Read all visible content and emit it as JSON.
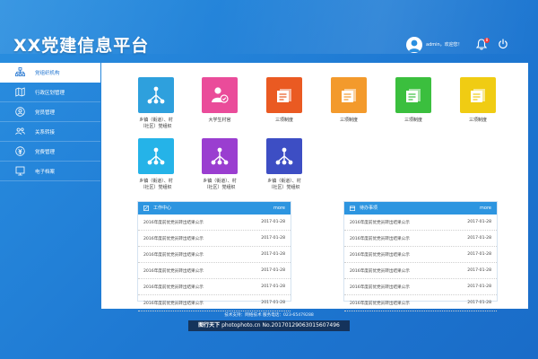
{
  "header": {
    "title": "XX党建信息平台",
    "welcome": "admin，欢迎您！",
    "notification_count": "8"
  },
  "sidebar": {
    "items": [
      {
        "label": "党组织机构",
        "icon": "org-chart-icon"
      },
      {
        "label": "行政区划管理",
        "icon": "map-icon"
      },
      {
        "label": "党员管理",
        "icon": "member-icon"
      },
      {
        "label": "关系转接",
        "icon": "transfer-icon"
      },
      {
        "label": "党费管理",
        "icon": "fee-icon"
      },
      {
        "label": "电子档案",
        "icon": "archive-icon"
      }
    ]
  },
  "tiles": [
    {
      "label": "乡镇（街道）、村\n（社区）党组织",
      "color": "#2ea0dd",
      "icon": "org-tree-icon"
    },
    {
      "label": "大学生村官",
      "color": "#ea4c9a",
      "icon": "person-badge-icon"
    },
    {
      "label": "三项制度",
      "color": "#ea5a22",
      "icon": "document-icon"
    },
    {
      "label": "三项制度",
      "color": "#f39a2c",
      "icon": "document-icon"
    },
    {
      "label": "三项制度",
      "color": "#3bbf3e",
      "icon": "document-icon"
    },
    {
      "label": "三项制度",
      "color": "#f0cc13",
      "icon": "document-icon"
    },
    {
      "label": "乡镇（街道）、村\n（社区）党组织",
      "color": "#25b3e8",
      "icon": "org-tree-icon"
    },
    {
      "label": "乡镇（街道）、村\n（社区）党组织",
      "color": "#9a3ed0",
      "icon": "org-tree-icon"
    },
    {
      "label": "乡镇（街道）、村\n（社区）党组织",
      "color": "#3d4ec4",
      "icon": "org-tree-icon"
    }
  ],
  "work_center": {
    "title": "工作中心",
    "more": "more",
    "rows": [
      {
        "text": "2016年度前优党员转出结果公示",
        "date": "2017-01-28"
      },
      {
        "text": "2016年度前优党员转出结果公示",
        "date": "2017-01-28"
      },
      {
        "text": "2016年度前优党员转出结果公示",
        "date": "2017-01-28"
      },
      {
        "text": "2016年度前优党员转出结果公示",
        "date": "2017-01-28"
      },
      {
        "text": "2016年度前优党员转出结果公示",
        "date": "2017-01-28"
      },
      {
        "text": "2016年度前优党员转出结果公示",
        "date": "2017-01-28"
      }
    ]
  },
  "todo": {
    "title": "待办事项",
    "more": "more",
    "rows": [
      {
        "text": "2016年度前优党员转出结果公示",
        "date": "2017-01-28"
      },
      {
        "text": "2016年度前优党员转出结果公示",
        "date": "2017-01-28"
      },
      {
        "text": "2016年度前优党员转出结果公示",
        "date": "2017-01-28"
      },
      {
        "text": "2016年度前优党员转出结果公示",
        "date": "2017-01-28"
      },
      {
        "text": "2016年度前优党员转出结果公示",
        "date": "2017-01-28"
      },
      {
        "text": "2016年度前优党员转出结果公示",
        "date": "2017-01-28"
      }
    ]
  },
  "footer": {
    "text": "技术支持：网络技术   服务电话：023-65479288"
  },
  "watermark": {
    "brand": "图行天下",
    "url": "photophoto.cn",
    "number": "No.20170129063015607496"
  }
}
